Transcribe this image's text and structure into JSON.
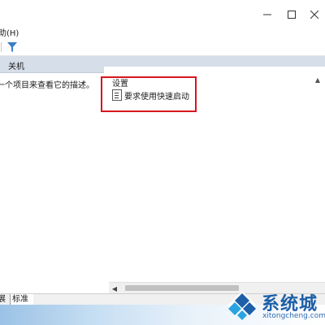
{
  "window": {
    "controls": {
      "minimize": "—",
      "maximize": "☐",
      "close": "✕"
    }
  },
  "menubar": {
    "help_label": "助(H)"
  },
  "toolbar": {
    "filter_icon": "filter-icon"
  },
  "pane_header": {
    "title": "关机"
  },
  "left_pane": {
    "description": "一个项目来查看它的描述。"
  },
  "settings": {
    "group_title": "设置",
    "items": [
      {
        "label": "要求使用快速启动",
        "icon": "setting-policy-icon"
      }
    ],
    "highlight_color": "#d6161d"
  },
  "tabs": [
    {
      "label": "展"
    },
    {
      "label": "标准"
    }
  ],
  "watermark": {
    "brand": "系统城",
    "url": "xitongcheng.com"
  },
  "colors": {
    "pane_header": "#d6dee9",
    "brand_blue": "#1d5fa8"
  }
}
